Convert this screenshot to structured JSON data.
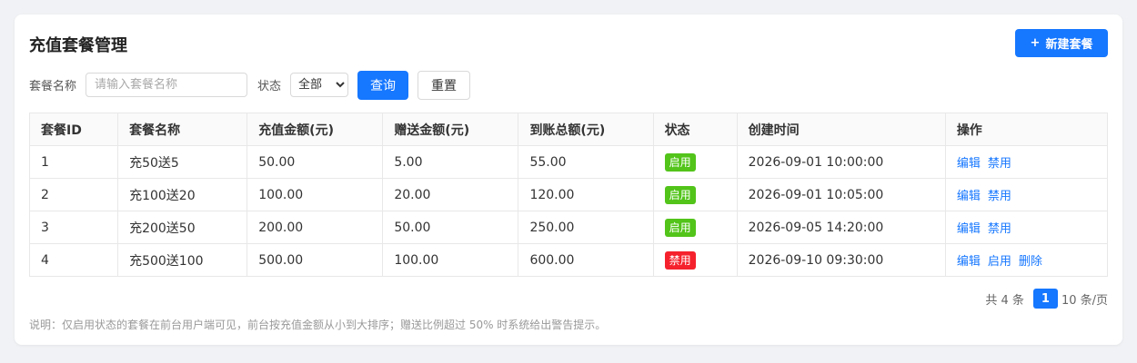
{
  "header": {
    "title": "充值套餐管理",
    "create_icon": "+",
    "create_label": "新建套餐"
  },
  "filter": {
    "name_label": "套餐名称",
    "name_placeholder": "请输入套餐名称",
    "name_value": "",
    "status_label": "状态",
    "status_selected": "全部",
    "query_label": "查询",
    "reset_label": "重置"
  },
  "table": {
    "columns": [
      "套餐ID",
      "套餐名称",
      "充值金额(元)",
      "赠送金额(元)",
      "到账总额(元)",
      "状态",
      "创建时间",
      "操作"
    ],
    "rows": [
      {
        "id": "1",
        "name": "充50送5",
        "recharge": "50.00",
        "bonus": "5.00",
        "total": "55.00",
        "status": "启用",
        "status_type": "on",
        "created": "2026-09-01 10:00:00",
        "actions": [
          "编辑",
          "禁用"
        ]
      },
      {
        "id": "2",
        "name": "充100送20",
        "recharge": "100.00",
        "bonus": "20.00",
        "total": "120.00",
        "status": "启用",
        "status_type": "on",
        "created": "2026-09-01 10:05:00",
        "actions": [
          "编辑",
          "禁用"
        ]
      },
      {
        "id": "3",
        "name": "充200送50",
        "recharge": "200.00",
        "bonus": "50.00",
        "total": "250.00",
        "status": "启用",
        "status_type": "on",
        "created": "2026-09-05 14:20:00",
        "actions": [
          "编辑",
          "禁用"
        ]
      },
      {
        "id": "4",
        "name": "充500送100",
        "recharge": "500.00",
        "bonus": "100.00",
        "total": "600.00",
        "status": "禁用",
        "status_type": "off",
        "created": "2026-09-10 09:30:00",
        "actions": [
          "编辑",
          "启用",
          "删除"
        ]
      }
    ]
  },
  "pager": {
    "total_text": "共 4 条",
    "current_page": "1",
    "page_size_text": "10 条/页"
  },
  "note": "说明：仅启用状态的套餐在前台用户端可见，前台按充值金额从小到大排序；赠送比例超过 50% 时系统给出警告提示。",
  "colors": {
    "primary": "#1677ff",
    "enabled": "#52c41a",
    "disabled": "#f5222d"
  }
}
